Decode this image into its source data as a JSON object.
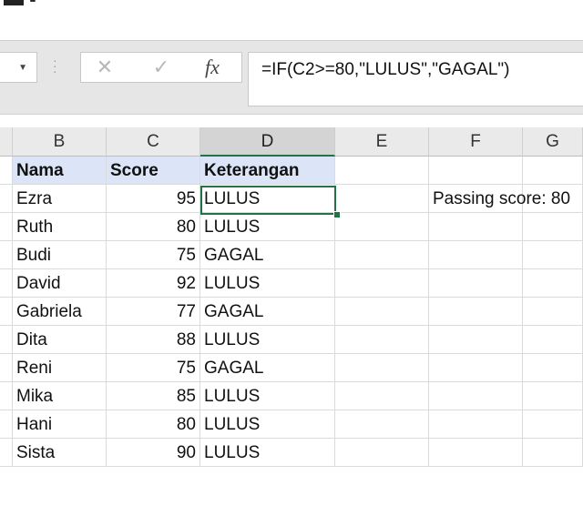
{
  "formula_bar": {
    "cancel_icon": "✕",
    "enter_icon": "✓",
    "fx_label": "fx",
    "formula": "=IF(C2>=80,\"LULUS\",\"GAGAL\")"
  },
  "columns": [
    {
      "id": "B",
      "label": "B"
    },
    {
      "id": "C",
      "label": "C"
    },
    {
      "id": "D",
      "label": "D",
      "selected": true
    },
    {
      "id": "E",
      "label": "E"
    },
    {
      "id": "F",
      "label": "F"
    },
    {
      "id": "G",
      "label": "G"
    }
  ],
  "table": {
    "headers": {
      "nama": "Nama",
      "score": "Score",
      "keterangan": "Keterangan"
    },
    "rows": [
      {
        "nama": "Ezra",
        "score": "95",
        "keterangan": "LULUS"
      },
      {
        "nama": "Ruth",
        "score": "80",
        "keterangan": "LULUS"
      },
      {
        "nama": "Budi",
        "score": "75",
        "keterangan": "GAGAL"
      },
      {
        "nama": "David",
        "score": "92",
        "keterangan": "LULUS"
      },
      {
        "nama": "Gabriela",
        "score": "77",
        "keterangan": "GAGAL"
      },
      {
        "nama": "Dita",
        "score": "88",
        "keterangan": "LULUS"
      },
      {
        "nama": "Reni",
        "score": "75",
        "keterangan": "GAGAL"
      },
      {
        "nama": "Mika",
        "score": "85",
        "keterangan": "LULUS"
      },
      {
        "nama": "Hani",
        "score": "80",
        "keterangan": "LULUS"
      },
      {
        "nama": "Sista",
        "score": "90",
        "keterangan": "LULUS"
      }
    ]
  },
  "note": "Passing score: 80",
  "colors": {
    "accent": "#217346",
    "header_fill": "#dbe5f7"
  }
}
